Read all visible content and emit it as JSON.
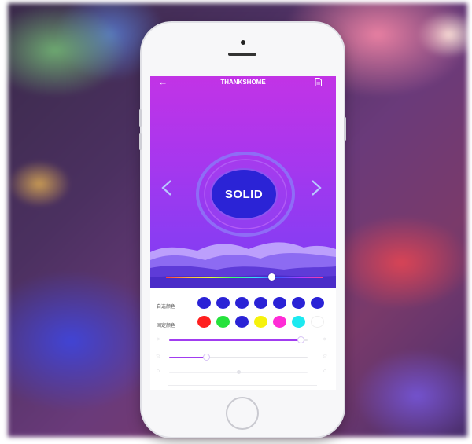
{
  "app": {
    "title": "THANKSHOME",
    "mode_label": "SOLID"
  },
  "icons": {
    "back": "arrow-left-icon",
    "save": "document-icon",
    "prev": "chevron-left-icon",
    "next": "chevron-right-icon"
  },
  "color_rows": [
    {
      "label": "自选颜色",
      "swatches": [
        "#2a22d6",
        "#2a22d6",
        "#2a22d6",
        "#2a22d6",
        "#2a22d6",
        "#2a22d6",
        "#2a22d6"
      ]
    },
    {
      "label": "固定颜色",
      "swatches": [
        "#ff1f1f",
        "#25e23c",
        "#2a22d6",
        "#f6f20c",
        "#ff2bd6",
        "#1de9f0",
        "#ffffff"
      ]
    }
  ],
  "sliders": {
    "brightness": 0.95,
    "speed": 0.27,
    "third": 0.5
  },
  "colors": {
    "accent": "#a13cf0",
    "solid_button": "#2b23d6"
  }
}
